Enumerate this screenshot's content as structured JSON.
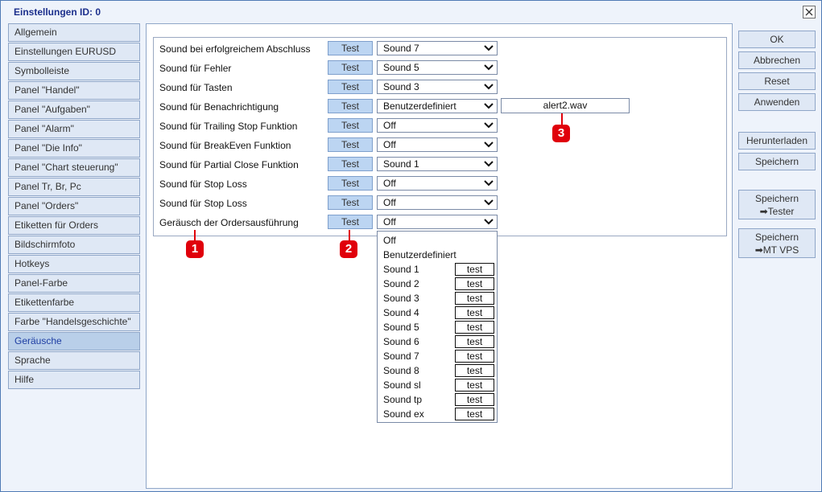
{
  "window": {
    "title": "Einstellungen   ID: 0"
  },
  "sidebar": {
    "items": [
      {
        "label": "Allgemein"
      },
      {
        "label": "Einstellungen EURUSD"
      },
      {
        "label": "Symbolleiste"
      },
      {
        "label": "Panel \"Handel\""
      },
      {
        "label": "Panel \"Aufgaben\""
      },
      {
        "label": "Panel \"Alarm\""
      },
      {
        "label": "Panel \"Die Info\""
      },
      {
        "label": "Panel \"Chart steuerung\""
      },
      {
        "label": "Panel Tr, Br, Pc"
      },
      {
        "label": "Panel \"Orders\""
      },
      {
        "label": "Etiketten für Orders"
      },
      {
        "label": "Bildschirmfoto"
      },
      {
        "label": "Hotkeys"
      },
      {
        "label": "Panel-Farbe"
      },
      {
        "label": "Etikettenfarbe"
      },
      {
        "label": "Farbe \"Handelsgeschichte\""
      },
      {
        "label": "Geräusche"
      },
      {
        "label": "Sprache"
      },
      {
        "label": "Hilfe"
      }
    ],
    "active": "Geräusche"
  },
  "sounds": {
    "test_label": "Test",
    "rows": [
      {
        "label": "Sound bei erfolgreichem Abschluss",
        "value": "Sound 7"
      },
      {
        "label": "Sound für Fehler",
        "value": "Sound 5"
      },
      {
        "label": "Sound für Tasten",
        "value": "Sound 3"
      },
      {
        "label": "Sound für Benachrichtigung",
        "value": "Benutzerdefiniert"
      },
      {
        "label": "Sound für Trailing Stop Funktion",
        "value": "Off"
      },
      {
        "label": "Sound für BreakEven Funktion",
        "value": "Off"
      },
      {
        "label": "Sound für Partial Close Funktion",
        "value": "Sound 1"
      },
      {
        "label": "Sound für Stop Loss",
        "value": "Off"
      },
      {
        "label": "Sound für Stop Loss",
        "value": "Off"
      },
      {
        "label": "Geräusch der Ordersausführung",
        "value": "Off"
      }
    ],
    "custom_file": "alert2.wav"
  },
  "dropdown": {
    "test_label": "test",
    "options": [
      {
        "label": "Off"
      },
      {
        "label": "Benutzerdefiniert"
      },
      {
        "label": "Sound 1"
      },
      {
        "label": "Sound 2"
      },
      {
        "label": "Sound 3"
      },
      {
        "label": "Sound 4"
      },
      {
        "label": "Sound 5"
      },
      {
        "label": "Sound 6"
      },
      {
        "label": "Sound 7"
      },
      {
        "label": "Sound 8"
      },
      {
        "label": "Sound sl"
      },
      {
        "label": "Sound tp"
      },
      {
        "label": "Sound ex"
      }
    ]
  },
  "markers": [
    "1",
    "2",
    "3"
  ],
  "buttons": {
    "ok": "OK",
    "cancel": "Abbrechen",
    "reset": "Reset",
    "apply": "Anwenden",
    "download": "Herunterladen",
    "save": "Speichern",
    "save_tester_line1": "Speichern",
    "save_tester_line2": "➡Tester",
    "save_vps_line1": "Speichern",
    "save_vps_line2": "➡MT VPS"
  },
  "colors": {
    "accent": "#1c2f8c",
    "marker": "#e0000b",
    "active_item": "#b9cfe9"
  }
}
